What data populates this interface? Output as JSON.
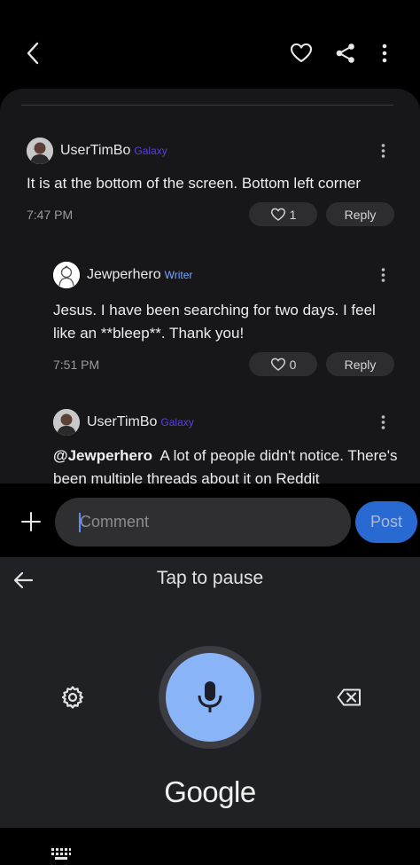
{
  "comments": [
    {
      "username": "UserTimBo",
      "badge": "Galaxy",
      "text": "It is at the bottom of the screen. Bottom left corner",
      "time": "7:47 PM",
      "likes": "1",
      "reply_label": "Reply"
    },
    {
      "username": "Jewperhero",
      "badge": "Writer",
      "text": "Jesus. I have been searching for two days. I feel like an **bleep**. Thank you!",
      "time": "7:51 PM",
      "likes": "0",
      "reply_label": "Reply"
    },
    {
      "username": "UserTimBo",
      "badge": "Galaxy",
      "mention": "@Jewperhero",
      "text": "A lot of people didn't notice. There's been multiple threads about it on Reddit"
    }
  ],
  "composer": {
    "placeholder": "Comment",
    "post_label": "Post"
  },
  "voice": {
    "title": "Tap to pause",
    "brand": "Google"
  },
  "colors": {
    "galaxy_badge": "#5b3ee0",
    "writer_badge": "#7aa7ff",
    "post_button": "#2f7df6",
    "mic_button": "#8ab4f8"
  },
  "icons": {
    "back": "back-chevron-icon",
    "favorite": "heart-icon",
    "share": "share-icon",
    "more": "more-vertical-icon"
  }
}
